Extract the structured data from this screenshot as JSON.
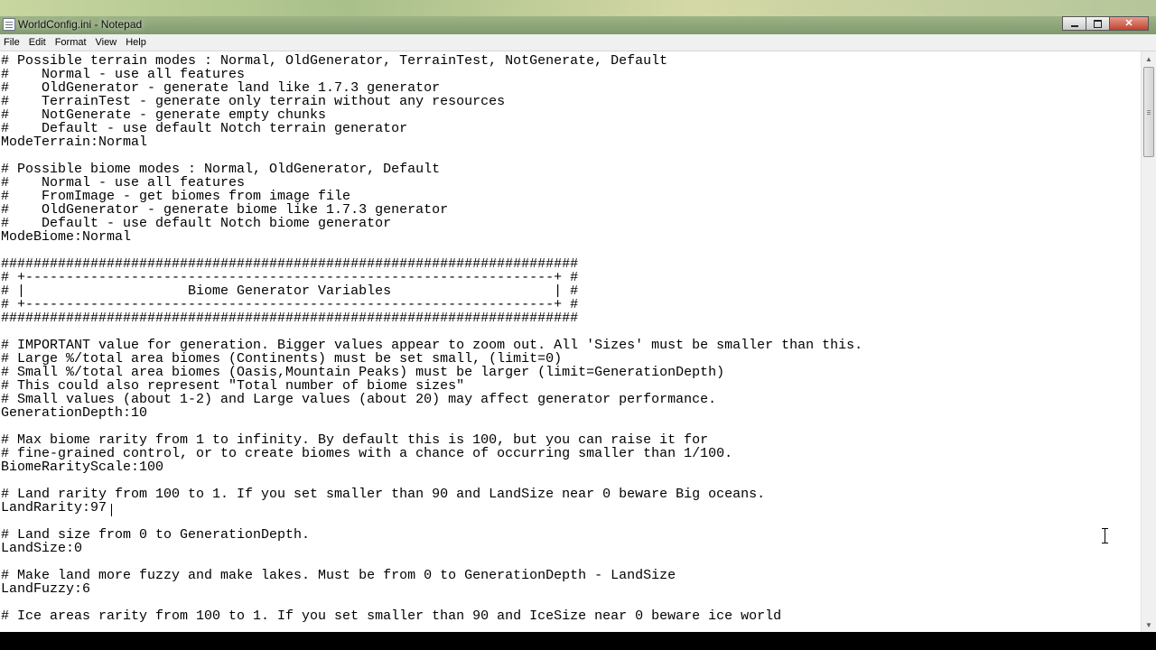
{
  "window": {
    "title": "WorldConfig.ini - Notepad",
    "controls": {
      "minimize": "",
      "maximize": "",
      "close": "✕"
    }
  },
  "menu": [
    "File",
    "Edit",
    "Format",
    "View",
    "Help"
  ],
  "editor": {
    "lines": [
      "# Possible terrain modes : Normal, OldGenerator, TerrainTest, NotGenerate, Default",
      "#    Normal - use all features",
      "#    OldGenerator - generate land like 1.7.3 generator",
      "#    TerrainTest - generate only terrain without any resources",
      "#    NotGenerate - generate empty chunks",
      "#    Default - use default Notch terrain generator",
      "ModeTerrain:Normal",
      "",
      "# Possible biome modes : Normal, OldGenerator, Default",
      "#    Normal - use all features",
      "#    FromImage - get biomes from image file",
      "#    OldGenerator - generate biome like 1.7.3 generator",
      "#    Default - use default Notch biome generator",
      "ModeBiome:Normal",
      "",
      "#######################################################################",
      "# +-----------------------------------------------------------------+ #",
      "# |                    Biome Generator Variables                    | #",
      "# +-----------------------------------------------------------------+ #",
      "#######################################################################",
      "",
      "# IMPORTANT value for generation. Bigger values appear to zoom out. All 'Sizes' must be smaller than this.",
      "# Large %/total area biomes (Continents) must be set small, (limit=0)",
      "# Small %/total area biomes (Oasis,Mountain Peaks) must be larger (limit=GenerationDepth)",
      "# This could also represent \"Total number of biome sizes\"",
      "# Small values (about 1-2) and Large values (about 20) may affect generator performance.",
      "GenerationDepth:10",
      "",
      "# Max biome rarity from 1 to infinity. By default this is 100, but you can raise it for",
      "# fine-grained control, or to create biomes with a chance of occurring smaller than 1/100.",
      "BiomeRarityScale:100",
      "",
      "# Land rarity from 100 to 1. If you set smaller than 90 and LandSize near 0 beware Big oceans.",
      "LandRarity:97",
      "",
      "# Land size from 0 to GenerationDepth.",
      "LandSize:0",
      "",
      "# Make land more fuzzy and make lakes. Must be from 0 to GenerationDepth - LandSize",
      "LandFuzzy:6",
      "",
      "# Ice areas rarity from 100 to 1. If you set smaller than 90 and IceSize near 0 beware ice world"
    ]
  },
  "icons": {
    "app": "notepad-icon",
    "scroll_up": "▲",
    "scroll_down": "▼",
    "cursor": "ibeam-cursor-icon"
  }
}
